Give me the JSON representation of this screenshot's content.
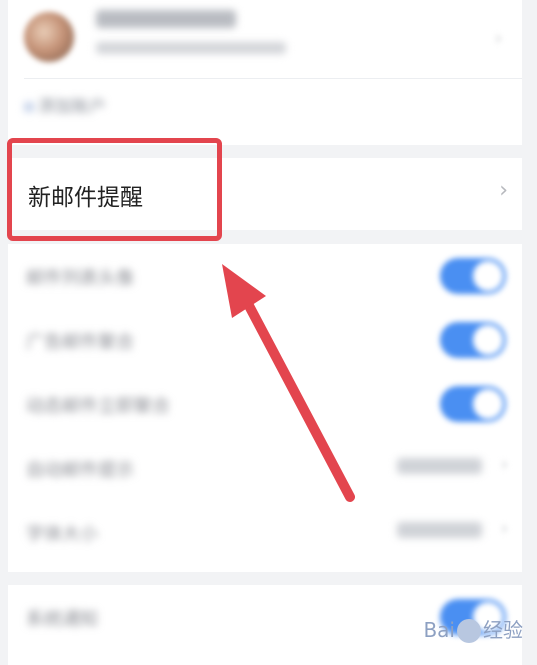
{
  "highlight_row": {
    "label": "新邮件提醒",
    "chevron": "›"
  },
  "account": {
    "arrow": "›",
    "manage_label": "添加账户"
  },
  "settings_rows": [
    {
      "label": "邮件列表头像",
      "toggle_on": true
    },
    {
      "label": "广告邮件聚合",
      "toggle_on": true
    },
    {
      "label": "动态邮件立即聚合",
      "toggle_on": true
    },
    {
      "label": "自动邮件提示",
      "value": ""
    },
    {
      "label": "字体大小",
      "value": ""
    }
  ],
  "footer_row": {
    "label": "系统通知",
    "toggle_on": true
  },
  "watermark": {
    "brand_left": "Bai",
    "brand_right": "经验"
  },
  "colors": {
    "highlight": "#e3454e",
    "toggle": "#4a8ff2"
  },
  "icons": [
    "avatar-image",
    "chevron-right-icon",
    "annotation-arrow",
    "baidu-paw-icon"
  ]
}
